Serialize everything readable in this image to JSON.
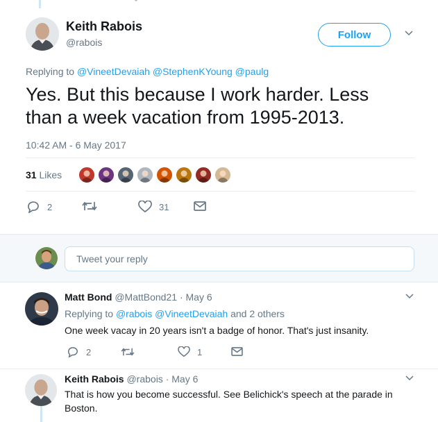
{
  "main_tweet": {
    "author_name": "Keith Rabois",
    "author_handle": "@rabois",
    "follow_label": "Follow",
    "replying_prefix": "Replying to",
    "replying_to": [
      "@VineetDevaiah",
      "@StephenKYoung",
      "@paulg"
    ],
    "text_line1": "Yes. But this because I work harder.  Less",
    "text_line2": "than a week vacation from 1995-2013.",
    "timestamp": "10:42 AM - 6 May 2017",
    "likes_count": "31",
    "likes_label": "Likes",
    "actions": {
      "replies": "2",
      "retweets": "",
      "likes": "31"
    },
    "liker_colors": [
      "#c0392b",
      "#6c3483",
      "#566573",
      "#aeb6bf",
      "#d35400",
      "#b9770e",
      "#922b21",
      "#d5b895"
    ]
  },
  "reply_composer": {
    "placeholder": "Tweet your reply"
  },
  "replies": [
    {
      "author_name": "Matt Bond",
      "author_handle": "@MattBond21",
      "date": "· May 6",
      "replying_prefix": "Replying to",
      "replying_to": [
        "@rabois",
        "@VineetDevaiah"
      ],
      "replying_suffix": "and 2 others",
      "text": "One week vacay in 20 years isn't a badge of honor. That's just insanity.",
      "actions": {
        "replies": "2",
        "retweets": "",
        "likes": "1"
      }
    },
    {
      "author_name": "Keith Rabois",
      "author_handle": "@rabois",
      "date": "· May 6",
      "text_line1": "That is how you become successful.  See Belichick's speech at the parade in",
      "text_line2": "Boston."
    }
  ],
  "colors": {
    "accent": "#1da1f2",
    "muted": "#657786",
    "like": "#e0245e"
  },
  "icons": [
    "reply-icon",
    "retweet-icon",
    "like-icon",
    "message-icon",
    "chevron-down-icon"
  ]
}
